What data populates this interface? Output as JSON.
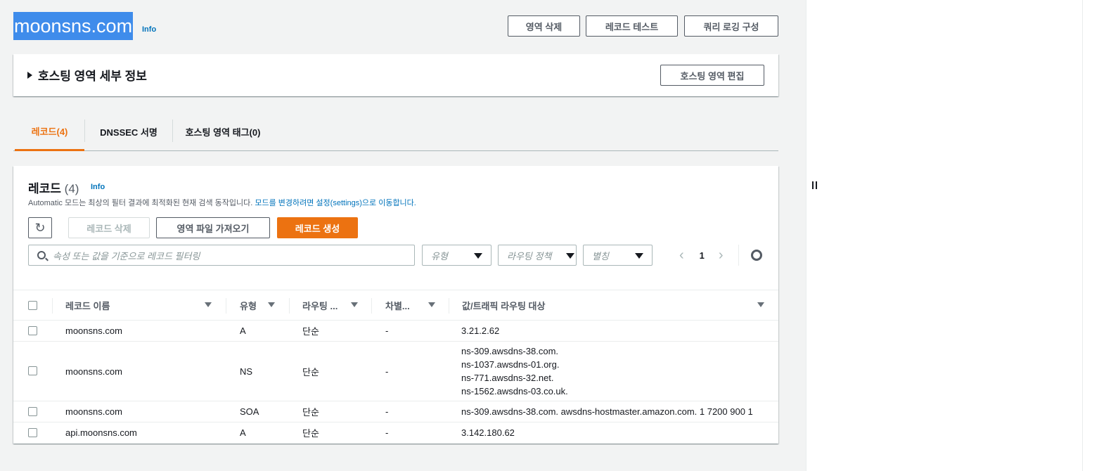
{
  "zone": {
    "title": "moonsns.com",
    "info": "Info",
    "actions": {
      "delete_zone": "영역 삭제",
      "test_record": "레코드 테스트",
      "query_logging": "쿼리 로깅 구성"
    }
  },
  "details": {
    "title": "호스팅 영역 세부 정보",
    "edit_button": "호스팅 영역 편집"
  },
  "tabs": [
    {
      "label": "레코드(4)",
      "active": true
    },
    {
      "label": "DNSSEC 서명",
      "active": false
    },
    {
      "label": "호스팅 영역 태그(0)",
      "active": false
    }
  ],
  "records": {
    "title": "레코드",
    "count": "(4)",
    "info": "Info",
    "desc_prefix": "Automatic 모드는 최상의 필터 결과에 최적화된 현재 검색 동작입니다. ",
    "desc_link": "모드를 변경하려면 설정(settings)으로 이동합니다.",
    "buttons": {
      "refresh_icon": "refresh-icon",
      "delete": "레코드 삭제",
      "import": "영역 파일 가져오기",
      "create": "레코드 생성"
    },
    "search_placeholder": "속성 또는 값을 기준으로 레코드 필터링",
    "filters": {
      "type": "유형",
      "routing": "라우팅 정책",
      "alias": "별칭"
    },
    "pager": {
      "page": "1"
    },
    "columns": {
      "name": "레코드 이름",
      "type": "유형",
      "routing": "라우팅 ...",
      "differentiator": "차별...",
      "value": "값/트래픽 라우팅 대상"
    },
    "rows": [
      {
        "name": "moonsns.com",
        "type": "A",
        "routing": "단순",
        "diff": "-",
        "values": [
          "3.21.2.62"
        ]
      },
      {
        "name": "moonsns.com",
        "type": "NS",
        "routing": "단순",
        "diff": "-",
        "values": [
          "ns-309.awsdns-38.com.",
          "ns-1037.awsdns-01.org.",
          "ns-771.awsdns-32.net.",
          "ns-1562.awsdns-03.co.uk."
        ]
      },
      {
        "name": "moonsns.com",
        "type": "SOA",
        "routing": "단순",
        "diff": "-",
        "values": [
          "ns-309.awsdns-38.com. awsdns-hostmaster.amazon.com. 1 7200 900 1"
        ]
      },
      {
        "name": "api.moonsns.com",
        "type": "A",
        "routing": "단순",
        "diff": "-",
        "values": [
          "3.142.180.62"
        ]
      }
    ]
  },
  "colors": {
    "accent": "#ec7211",
    "link": "#0073bb",
    "selection": "#3f8ceb"
  }
}
